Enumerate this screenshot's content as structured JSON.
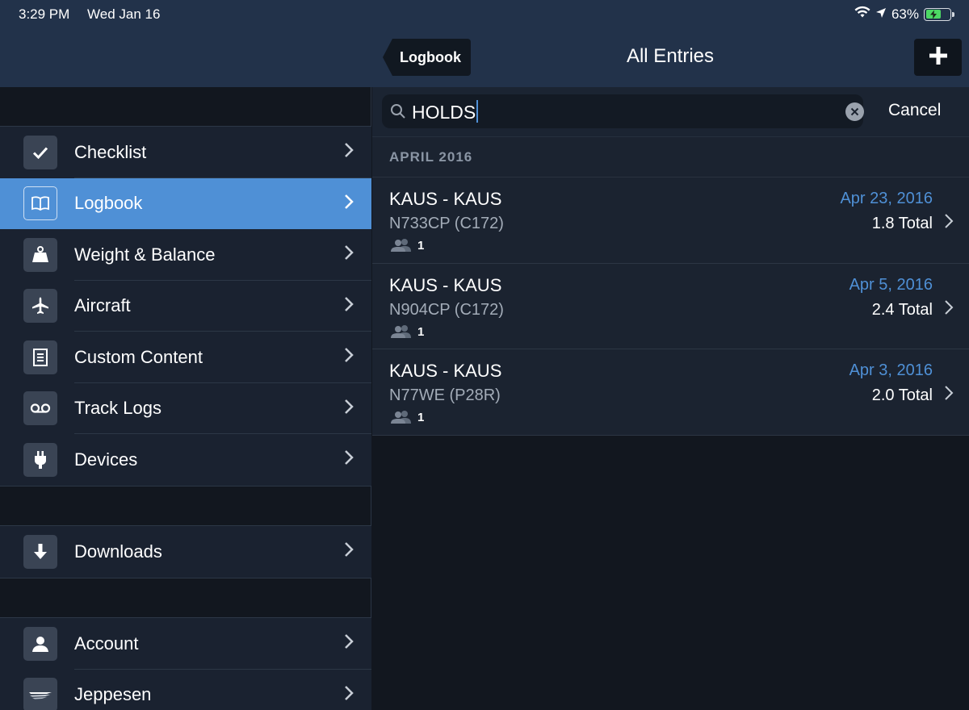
{
  "status": {
    "time": "3:29 PM",
    "date": "Wed Jan 16",
    "battery": "63%",
    "battery_level": 0.63
  },
  "nav": {
    "back_label": "Logbook",
    "title": "All Entries",
    "add_icon": "plus-icon"
  },
  "sidebar": {
    "items": [
      {
        "label": "Checklist",
        "icon": "checkmark-icon"
      },
      {
        "label": "Logbook",
        "icon": "book-icon",
        "active": true
      },
      {
        "label": "Weight & Balance",
        "icon": "weight-icon"
      },
      {
        "label": "Aircraft",
        "icon": "airplane-icon"
      },
      {
        "label": "Custom Content",
        "icon": "document-icon"
      },
      {
        "label": "Track Logs",
        "icon": "tape-icon"
      },
      {
        "label": "Devices",
        "icon": "plug-icon"
      }
    ],
    "downloads": {
      "label": "Downloads",
      "icon": "download-icon"
    },
    "account": {
      "label": "Account",
      "icon": "person-icon"
    },
    "jeppesen": {
      "label": "Jeppesen",
      "icon": "jeppesen-icon"
    }
  },
  "search": {
    "value": "HOLDS",
    "cancel_label": "Cancel"
  },
  "section": {
    "title": "APRIL 2016"
  },
  "entries": [
    {
      "route": "KAUS - KAUS",
      "aircraft": "N733CP (C172)",
      "people": "1",
      "date": "Apr 23, 2016",
      "total": "1.8 Total"
    },
    {
      "route": "KAUS - KAUS",
      "aircraft": "N904CP (C172)",
      "people": "1",
      "date": "Apr 5, 2016",
      "total": "2.4 Total"
    },
    {
      "route": "KAUS - KAUS",
      "aircraft": "N77WE (P28R)",
      "people": "1",
      "date": "Apr 3, 2016",
      "total": "2.0 Total"
    }
  ],
  "colors": {
    "accent": "#4f90d6",
    "header": "#22324a",
    "background": "#12171f",
    "row": "#1b2330"
  }
}
